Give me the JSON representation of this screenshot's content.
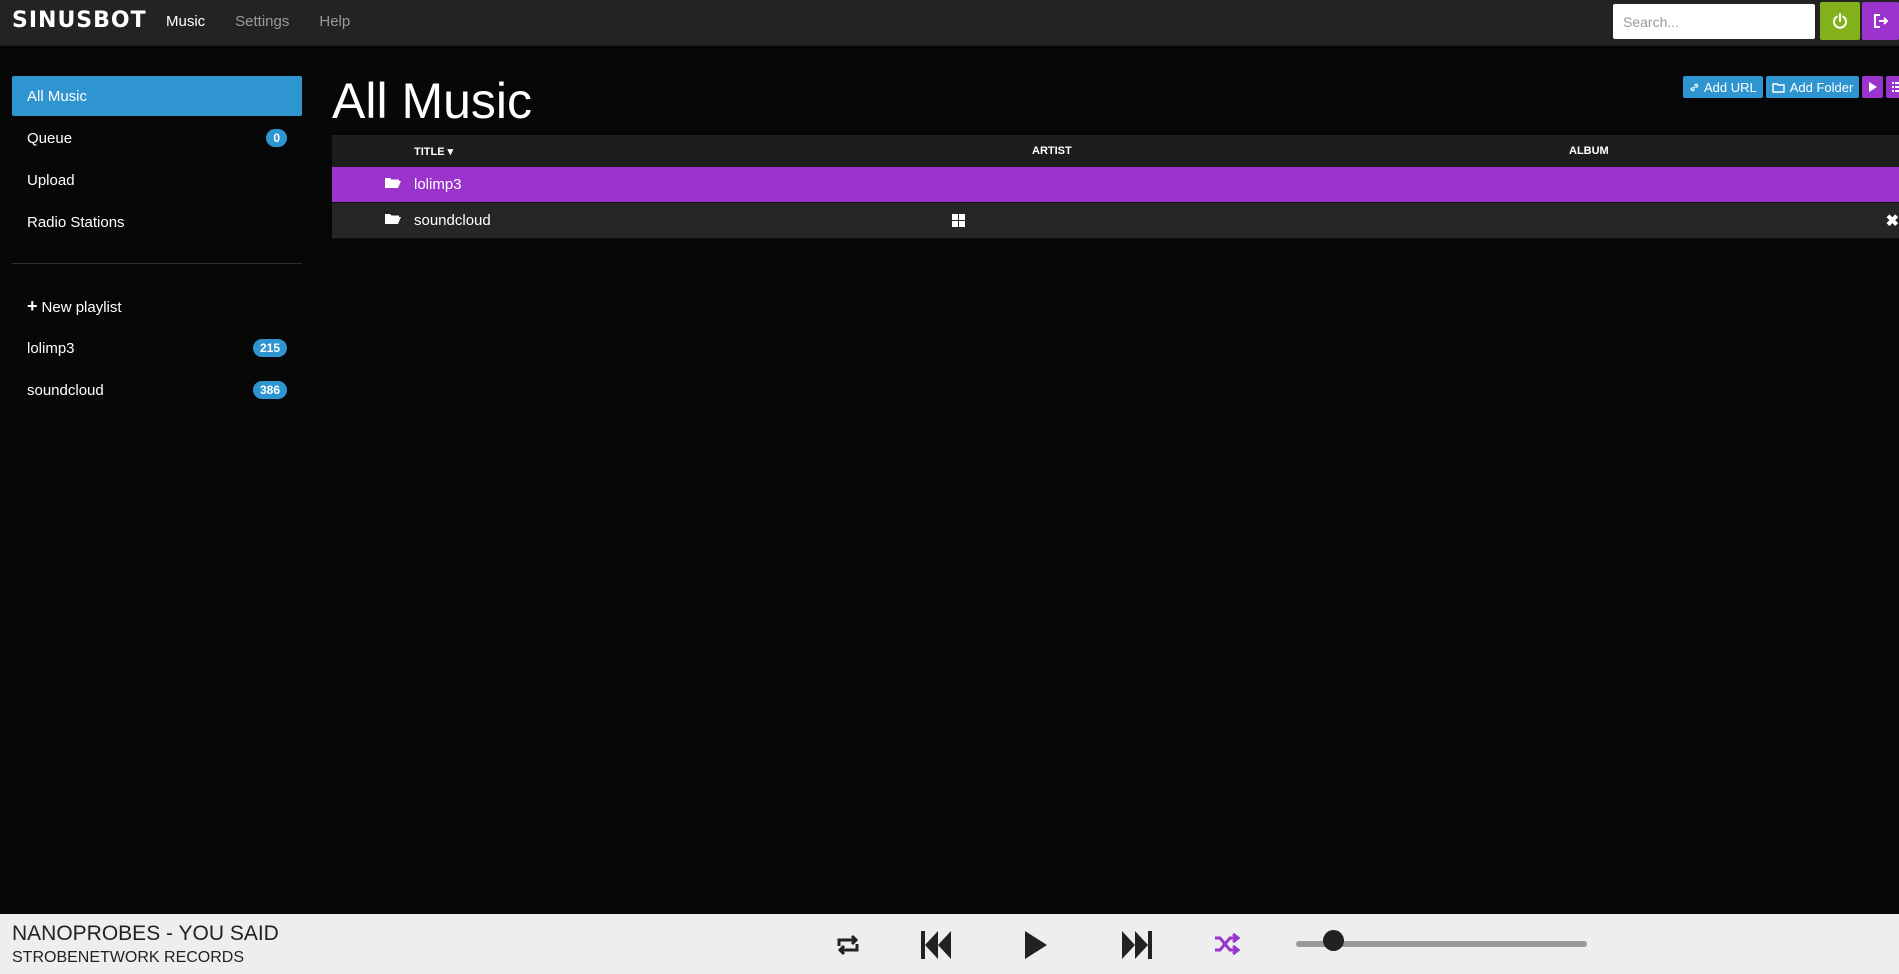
{
  "brand": "SINUSBOT",
  "nav": [
    {
      "label": "Music",
      "active": true
    },
    {
      "label": "Settings",
      "active": false
    },
    {
      "label": "Help",
      "active": false
    }
  ],
  "search": {
    "placeholder": "Search..."
  },
  "sidebar": {
    "items": [
      {
        "label": "All Music",
        "active": true
      },
      {
        "label": "Queue",
        "badge": "0"
      },
      {
        "label": "Upload"
      },
      {
        "label": "Radio Stations"
      }
    ],
    "new_playlist": "New playlist",
    "playlists": [
      {
        "label": "lolimp3",
        "count": "215"
      },
      {
        "label": "soundcloud",
        "count": "386"
      }
    ]
  },
  "main": {
    "title": "All Music",
    "add_url": "Add URL",
    "add_folder": "Add Folder",
    "columns": {
      "title": "TITLE",
      "artist": "ARTIST",
      "album": "ALBUM"
    },
    "rows": [
      {
        "title": "lolimp3"
      },
      {
        "title": "soundcloud"
      }
    ]
  },
  "player": {
    "track": "NANOPROBES - YOU SAID",
    "label": "STROBENETWORK RECORDS",
    "volume": 0.13
  },
  "colors": {
    "accent": "#2f95d1",
    "purple": "#9b33cd",
    "green": "#83b11c"
  }
}
